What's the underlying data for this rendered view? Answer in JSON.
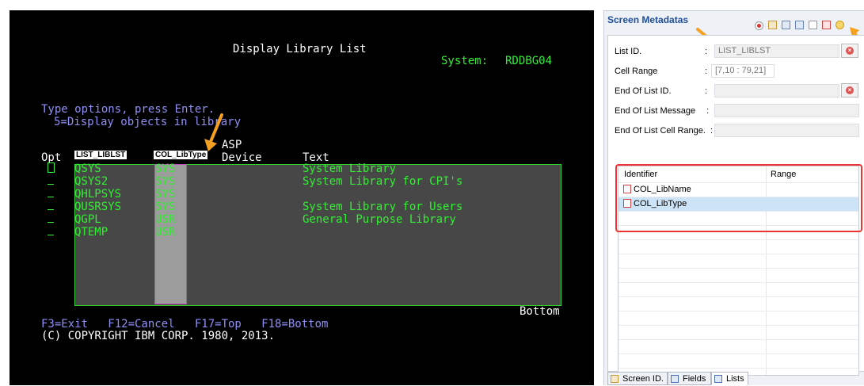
{
  "terminal": {
    "title": "Display Library List",
    "system_label": "System:",
    "system_name": "RDDBG04",
    "instructions": "Type options, press Enter.",
    "option_5": "5=Display objects in library",
    "col_opt": "Opt",
    "col_asp_line1": "ASP",
    "col_asp_line2": "Device",
    "col_text": "Text",
    "tag_list": "LIST_LIBLST",
    "tag_col": "COL_LibType",
    "rows": [
      {
        "name": "QSYS",
        "type": "SYS",
        "text": "System Library"
      },
      {
        "name": "QSYS2",
        "type": "SYS",
        "text": "System Library for CPI's"
      },
      {
        "name": "QHLPSYS",
        "type": "SYS",
        "text": ""
      },
      {
        "name": "QUSRSYS",
        "type": "SYS",
        "text": "System Library for Users"
      },
      {
        "name": "QGPL",
        "type": "USR",
        "text": "General Purpose Library"
      },
      {
        "name": "QTEMP",
        "type": "USR",
        "text": ""
      }
    ],
    "bottom": "Bottom",
    "fkeys": "F3=Exit   F12=Cancel   F17=Top   F18=Bottom",
    "copyright": "(C) COPYRIGHT IBM CORP. 1980, 2013."
  },
  "panel": {
    "title": "Screen Metadatas",
    "fields": {
      "list_id_label": "List ID.",
      "list_id_value": "LIST_LIBLST",
      "cell_range_label": "Cell Range",
      "cell_range_value": "[7,10 : 79,21]",
      "eol_id_label": "End Of List ID.",
      "eol_msg_label": "End Of List Message",
      "eol_cell_label": "End Of List Cell Range.",
      "colon": ":"
    },
    "table": {
      "col_identifier": "Identifier",
      "col_range": "Range",
      "rows": [
        "COL_LibName",
        "COL_LibType"
      ]
    },
    "tabs": [
      "Screen ID.",
      "Fields",
      "Lists"
    ],
    "accent": "#1f4f9a",
    "highlight": "#e33333"
  }
}
